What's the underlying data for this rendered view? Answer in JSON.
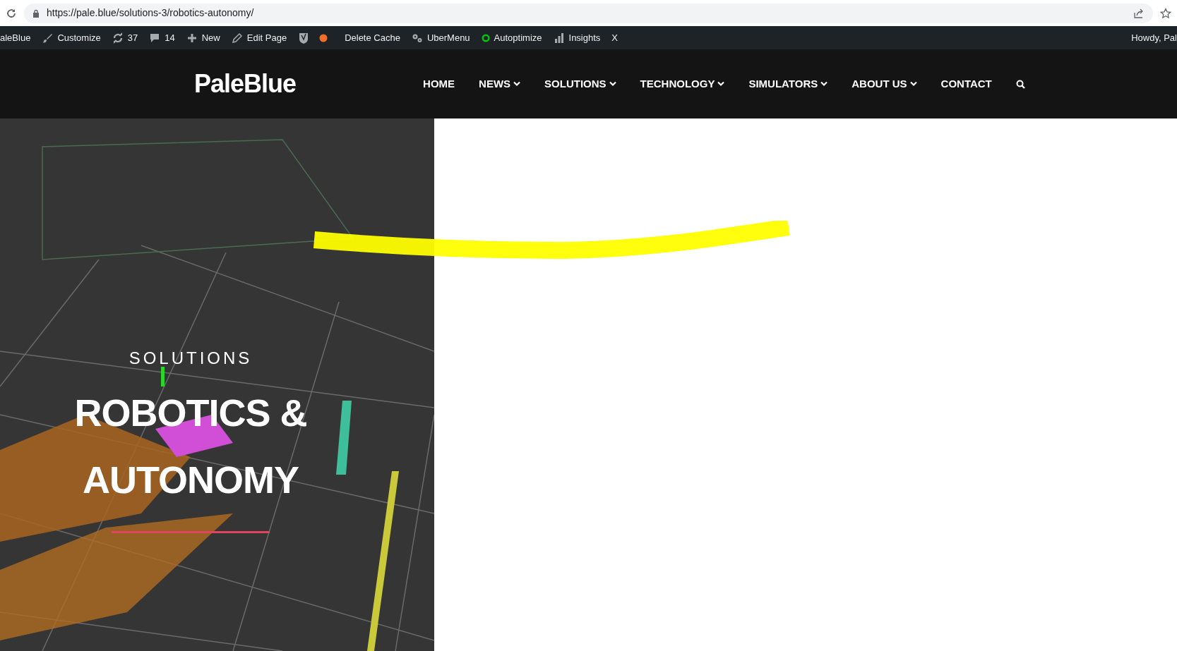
{
  "browser": {
    "url": "https://pale.blue/solutions-3/robotics-autonomy/"
  },
  "admin_bar": {
    "items": [
      {
        "label": "aleBlue",
        "kind": "site"
      },
      {
        "label": "Customize",
        "kind": "link"
      },
      {
        "label": "37",
        "kind": "link"
      },
      {
        "label": "14",
        "kind": "link"
      },
      {
        "label": "New",
        "kind": "link"
      },
      {
        "label": "Edit Page",
        "kind": "link"
      },
      {
        "kind": "status",
        "color": "#f56e28"
      },
      {
        "label": "Delete Cache",
        "kind": "link"
      },
      {
        "label": "UberMenu",
        "kind": "link"
      },
      {
        "label": "Autoptimize",
        "kind": "ring",
        "color": "#00c700"
      },
      {
        "label": "Insights",
        "kind": "link"
      },
      {
        "label": "X",
        "kind": "link"
      }
    ],
    "greeting": "Howdy, Pal"
  },
  "header": {
    "logo": "PaleBlue",
    "nav": [
      {
        "label": "HOME",
        "dropdown": false
      },
      {
        "label": "NEWS",
        "dropdown": true
      },
      {
        "label": "SOLUTIONS",
        "dropdown": true
      },
      {
        "label": "TECHNOLOGY",
        "dropdown": true
      },
      {
        "label": "SIMULATORS",
        "dropdown": true
      },
      {
        "label": "ABOUT US",
        "dropdown": true
      },
      {
        "label": "CONTACT",
        "dropdown": false
      }
    ]
  },
  "hero": {
    "kind": "picture",
    "eyebrow": "SOLUTIONS",
    "title": "ROBOTICS & AUTONOMY"
  }
}
